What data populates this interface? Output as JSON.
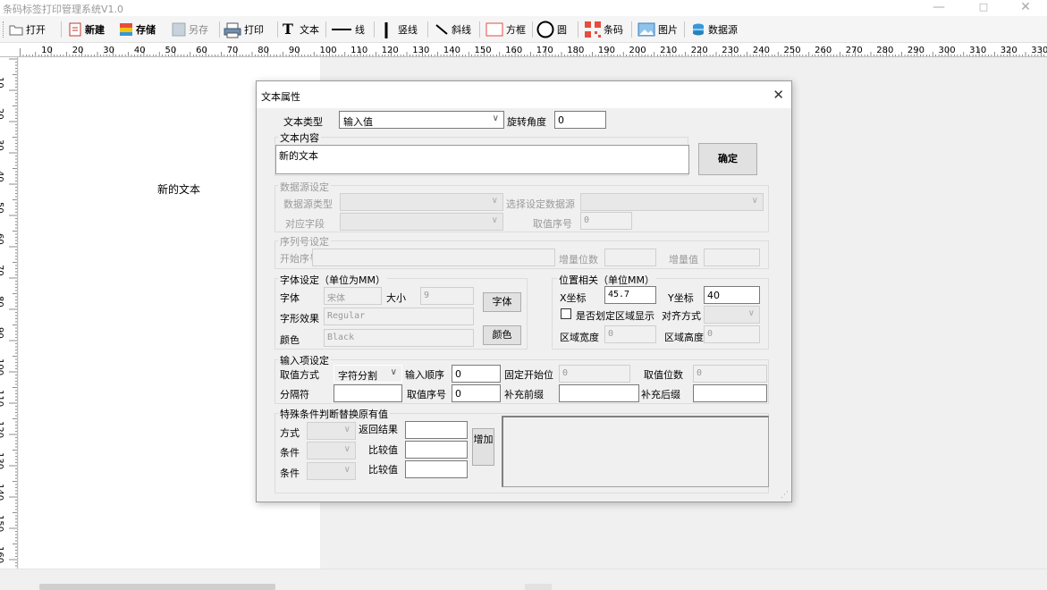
{
  "window": {
    "title": "条码标签打印管理系统V1.0",
    "minimize": "—",
    "maximize": "□",
    "close": "✕"
  },
  "toolbar": {
    "open": "打开",
    "new": "新建",
    "save": "存储",
    "save_as": "另存",
    "print": "打印",
    "text": "文本",
    "line": "线",
    "vline": "竖线",
    "diag": "斜线",
    "rect": "方框",
    "circle": "圆",
    "barcode": "条码",
    "image": "图片",
    "datasource": "数据源"
  },
  "ruler": {
    "h_labels": [
      "10",
      "20",
      "30",
      "40",
      "50",
      "60",
      "70",
      "80",
      "90",
      "100",
      "110",
      "120",
      "130",
      "140",
      "150",
      "160",
      "170",
      "180",
      "190",
      "200",
      "210",
      "220",
      "230",
      "240",
      "250",
      "260",
      "270",
      "280",
      "290",
      "300",
      "310",
      "320",
      "330"
    ],
    "v_labels": [
      "10",
      "20",
      "30",
      "40",
      "50",
      "60",
      "70",
      "80",
      "90",
      "100",
      "110",
      "120",
      "130",
      "140",
      "150",
      "160"
    ]
  },
  "canvas": {
    "text": "新的文本"
  },
  "dialog": {
    "title": "文本属性",
    "close": "✕",
    "text_type_label": "文本类型",
    "text_type_value": "输入值",
    "rotate_label": "旋转角度",
    "rotate_value": "0",
    "content_group": "文本内容",
    "content_value": "新的文本",
    "ok_button": "确定",
    "ds_group": "数据源设定",
    "ds_type_label": "数据源类型",
    "ds_select_label": "选择设定数据源",
    "field_label": "对应字段",
    "index_label": "取值序号",
    "index_value": "0",
    "serial_group": "序列号设定",
    "start_label": "开始序号",
    "inc_digits_label": "增量位数",
    "inc_value_label": "增量值",
    "font_group": "字体设定（单位为MM）",
    "font_label": "字体",
    "font_value": "宋体",
    "size_label": "大小",
    "size_value": "9",
    "font_button": "字体",
    "style_label": "字形效果",
    "style_value": "Regular",
    "color_label": "颜色",
    "color_value": "Black",
    "color_button": "颜色",
    "pos_group": "位置相关（单位MM）",
    "x_label": "X坐标",
    "x_value": "45.7",
    "y_label": "Y坐标",
    "y_value": "40",
    "region_check": "是否划定区域显示",
    "align_label": "对齐方式",
    "width_label": "区域宽度",
    "width_value": "0",
    "height_label": "区域高度",
    "height_value": "0",
    "input_group": "输入项设定",
    "mode_label": "取值方式",
    "mode_value": "字符分割",
    "order_label": "输入顺序",
    "order_value": "0",
    "fixed_start_label": "固定开始位",
    "fixed_start_value": "0",
    "digits_label": "取值位数",
    "digits_value": "0",
    "sep_label": "分隔符",
    "index2_label": "取值序号",
    "index2_value": "0",
    "prefix_label": "补充前缀",
    "suffix_label": "补充后缀",
    "special_group": "特殊条件判断替换原有值",
    "way_label": "方式",
    "return_label": "返回结果",
    "cond1_label": "条件",
    "cmp1_label": "比较值",
    "cond2_label": "条件",
    "cmp2_label": "比较值",
    "add_button": "增加"
  }
}
